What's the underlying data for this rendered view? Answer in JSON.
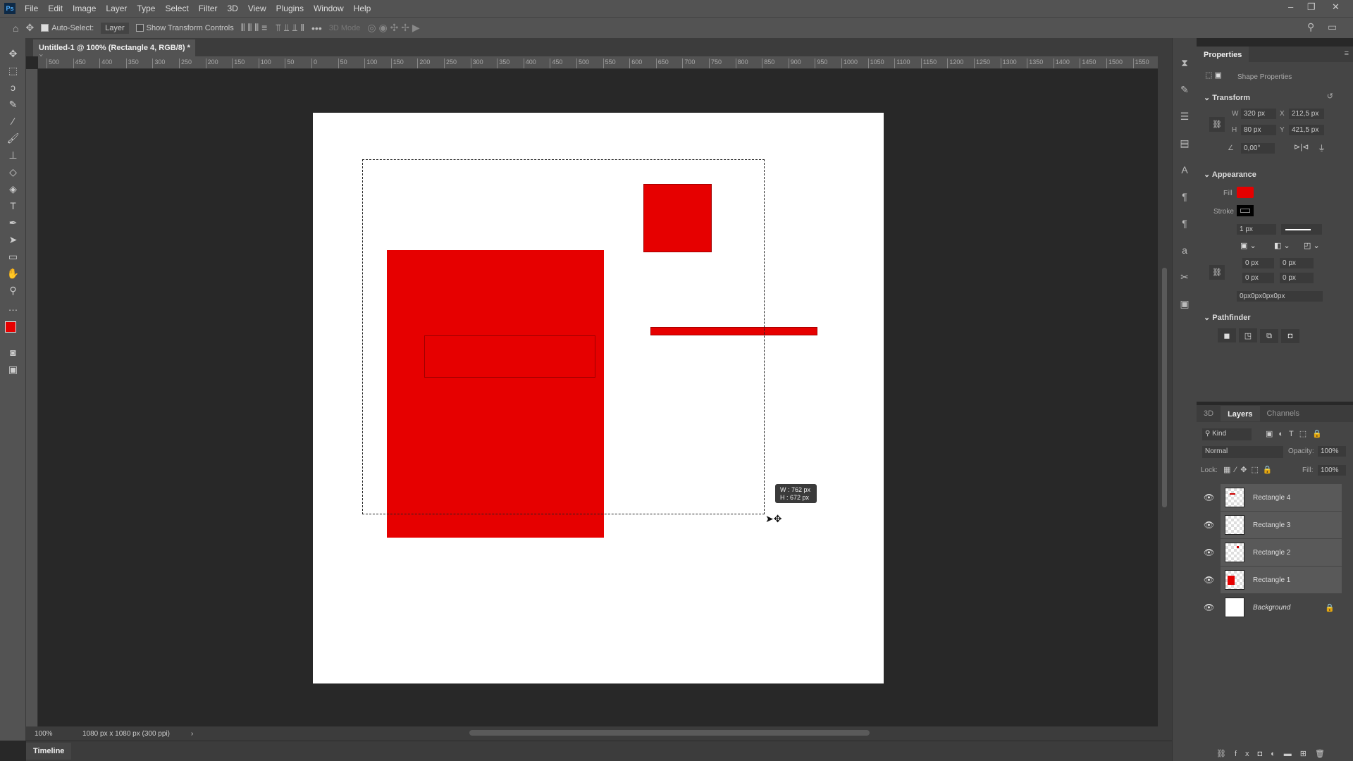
{
  "menu": [
    "File",
    "Edit",
    "Image",
    "Layer",
    "Type",
    "Select",
    "Filter",
    "3D",
    "View",
    "Plugins",
    "Window",
    "Help"
  ],
  "app_badge": "Ps",
  "options": {
    "auto_select": "Auto-Select:",
    "auto_select_target": "Layer",
    "show_transform": "Show Transform Controls",
    "mode_3d": "3D Mode"
  },
  "document_tab": {
    "title": "Untitled-1 @ 100% (Rectangle 4, RGB/8) *"
  },
  "ruler_labels": [
    "500",
    "450",
    "400",
    "350",
    "300",
    "250",
    "200",
    "150",
    "100",
    "50",
    "0",
    "50",
    "100",
    "150",
    "200",
    "250",
    "300",
    "350",
    "400",
    "450",
    "500",
    "550",
    "600",
    "650",
    "700",
    "750",
    "800",
    "850",
    "900",
    "950",
    "1000",
    "1050",
    "1100",
    "1150",
    "1200",
    "1250",
    "1300",
    "1350",
    "1400",
    "1450",
    "1500",
    "1550"
  ],
  "tooltip": {
    "w": "W : 762 px",
    "h": "H : 672 px"
  },
  "status": {
    "zoom": "100%",
    "doc_info": "1080 px x 1080 px (300 ppi)"
  },
  "timeline": "Timeline",
  "colors": {
    "foreground": "#e60000",
    "background": "#e60000",
    "shape_fill": "#e60000"
  },
  "properties": {
    "title": "Properties",
    "subtitle": "Shape Properties",
    "transform": {
      "label": "Transform",
      "w_label": "W",
      "w": "320 px",
      "h_label": "H",
      "h": "80 px",
      "x_label": "X",
      "x": "212,5 px",
      "y_label": "Y",
      "y": "421,5 px",
      "angle": "0,00°"
    },
    "appearance": {
      "label": "Appearance",
      "fill_label": "Fill",
      "stroke_label": "Stroke",
      "stroke_width": "1 px",
      "corners": [
        "0 px",
        "0 px",
        "0 px",
        "0 px"
      ],
      "corner_string": "0px0px0px0px"
    },
    "pathfinder": {
      "label": "Pathfinder"
    }
  },
  "layers_panel": {
    "tabs": [
      "3D",
      "Layers",
      "Channels"
    ],
    "filter": "Kind",
    "blend_mode": "Normal",
    "opacity_label": "Opacity:",
    "opacity": "100%",
    "lock_label": "Lock:",
    "fill_label": "Fill:",
    "fill": "100%",
    "layers": [
      {
        "name": "Rectangle 4"
      },
      {
        "name": "Rectangle 3"
      },
      {
        "name": "Rectangle 2"
      },
      {
        "name": "Rectangle 1"
      },
      {
        "name": "Background"
      }
    ]
  }
}
